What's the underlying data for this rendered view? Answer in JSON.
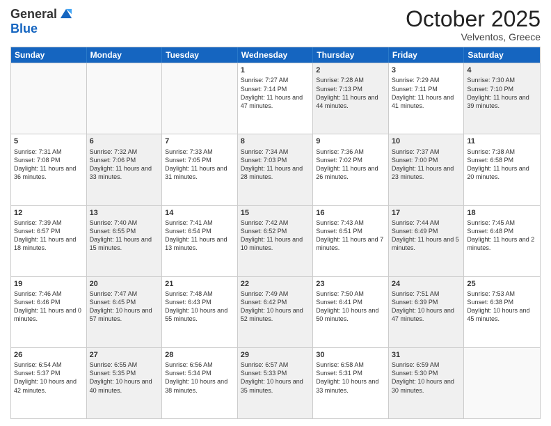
{
  "header": {
    "logo_general": "General",
    "logo_blue": "Blue",
    "month": "October 2025",
    "location": "Velventos, Greece"
  },
  "days_of_week": [
    "Sunday",
    "Monday",
    "Tuesday",
    "Wednesday",
    "Thursday",
    "Friday",
    "Saturday"
  ],
  "weeks": [
    [
      {
        "day": "",
        "sunrise": "",
        "sunset": "",
        "daylight": "",
        "shaded": false,
        "empty": true
      },
      {
        "day": "",
        "sunrise": "",
        "sunset": "",
        "daylight": "",
        "shaded": false,
        "empty": true
      },
      {
        "day": "",
        "sunrise": "",
        "sunset": "",
        "daylight": "",
        "shaded": false,
        "empty": true
      },
      {
        "day": "1",
        "sunrise": "Sunrise: 7:27 AM",
        "sunset": "Sunset: 7:14 PM",
        "daylight": "Daylight: 11 hours and 47 minutes.",
        "shaded": false,
        "empty": false
      },
      {
        "day": "2",
        "sunrise": "Sunrise: 7:28 AM",
        "sunset": "Sunset: 7:13 PM",
        "daylight": "Daylight: 11 hours and 44 minutes.",
        "shaded": true,
        "empty": false
      },
      {
        "day": "3",
        "sunrise": "Sunrise: 7:29 AM",
        "sunset": "Sunset: 7:11 PM",
        "daylight": "Daylight: 11 hours and 41 minutes.",
        "shaded": false,
        "empty": false
      },
      {
        "day": "4",
        "sunrise": "Sunrise: 7:30 AM",
        "sunset": "Sunset: 7:10 PM",
        "daylight": "Daylight: 11 hours and 39 minutes.",
        "shaded": true,
        "empty": false
      }
    ],
    [
      {
        "day": "5",
        "sunrise": "Sunrise: 7:31 AM",
        "sunset": "Sunset: 7:08 PM",
        "daylight": "Daylight: 11 hours and 36 minutes.",
        "shaded": false,
        "empty": false
      },
      {
        "day": "6",
        "sunrise": "Sunrise: 7:32 AM",
        "sunset": "Sunset: 7:06 PM",
        "daylight": "Daylight: 11 hours and 33 minutes.",
        "shaded": true,
        "empty": false
      },
      {
        "day": "7",
        "sunrise": "Sunrise: 7:33 AM",
        "sunset": "Sunset: 7:05 PM",
        "daylight": "Daylight: 11 hours and 31 minutes.",
        "shaded": false,
        "empty": false
      },
      {
        "day": "8",
        "sunrise": "Sunrise: 7:34 AM",
        "sunset": "Sunset: 7:03 PM",
        "daylight": "Daylight: 11 hours and 28 minutes.",
        "shaded": true,
        "empty": false
      },
      {
        "day": "9",
        "sunrise": "Sunrise: 7:36 AM",
        "sunset": "Sunset: 7:02 PM",
        "daylight": "Daylight: 11 hours and 26 minutes.",
        "shaded": false,
        "empty": false
      },
      {
        "day": "10",
        "sunrise": "Sunrise: 7:37 AM",
        "sunset": "Sunset: 7:00 PM",
        "daylight": "Daylight: 11 hours and 23 minutes.",
        "shaded": true,
        "empty": false
      },
      {
        "day": "11",
        "sunrise": "Sunrise: 7:38 AM",
        "sunset": "Sunset: 6:58 PM",
        "daylight": "Daylight: 11 hours and 20 minutes.",
        "shaded": false,
        "empty": false
      }
    ],
    [
      {
        "day": "12",
        "sunrise": "Sunrise: 7:39 AM",
        "sunset": "Sunset: 6:57 PM",
        "daylight": "Daylight: 11 hours and 18 minutes.",
        "shaded": false,
        "empty": false
      },
      {
        "day": "13",
        "sunrise": "Sunrise: 7:40 AM",
        "sunset": "Sunset: 6:55 PM",
        "daylight": "Daylight: 11 hours and 15 minutes.",
        "shaded": true,
        "empty": false
      },
      {
        "day": "14",
        "sunrise": "Sunrise: 7:41 AM",
        "sunset": "Sunset: 6:54 PM",
        "daylight": "Daylight: 11 hours and 13 minutes.",
        "shaded": false,
        "empty": false
      },
      {
        "day": "15",
        "sunrise": "Sunrise: 7:42 AM",
        "sunset": "Sunset: 6:52 PM",
        "daylight": "Daylight: 11 hours and 10 minutes.",
        "shaded": true,
        "empty": false
      },
      {
        "day": "16",
        "sunrise": "Sunrise: 7:43 AM",
        "sunset": "Sunset: 6:51 PM",
        "daylight": "Daylight: 11 hours and 7 minutes.",
        "shaded": false,
        "empty": false
      },
      {
        "day": "17",
        "sunrise": "Sunrise: 7:44 AM",
        "sunset": "Sunset: 6:49 PM",
        "daylight": "Daylight: 11 hours and 5 minutes.",
        "shaded": true,
        "empty": false
      },
      {
        "day": "18",
        "sunrise": "Sunrise: 7:45 AM",
        "sunset": "Sunset: 6:48 PM",
        "daylight": "Daylight: 11 hours and 2 minutes.",
        "shaded": false,
        "empty": false
      }
    ],
    [
      {
        "day": "19",
        "sunrise": "Sunrise: 7:46 AM",
        "sunset": "Sunset: 6:46 PM",
        "daylight": "Daylight: 11 hours and 0 minutes.",
        "shaded": false,
        "empty": false
      },
      {
        "day": "20",
        "sunrise": "Sunrise: 7:47 AM",
        "sunset": "Sunset: 6:45 PM",
        "daylight": "Daylight: 10 hours and 57 minutes.",
        "shaded": true,
        "empty": false
      },
      {
        "day": "21",
        "sunrise": "Sunrise: 7:48 AM",
        "sunset": "Sunset: 6:43 PM",
        "daylight": "Daylight: 10 hours and 55 minutes.",
        "shaded": false,
        "empty": false
      },
      {
        "day": "22",
        "sunrise": "Sunrise: 7:49 AM",
        "sunset": "Sunset: 6:42 PM",
        "daylight": "Daylight: 10 hours and 52 minutes.",
        "shaded": true,
        "empty": false
      },
      {
        "day": "23",
        "sunrise": "Sunrise: 7:50 AM",
        "sunset": "Sunset: 6:41 PM",
        "daylight": "Daylight: 10 hours and 50 minutes.",
        "shaded": false,
        "empty": false
      },
      {
        "day": "24",
        "sunrise": "Sunrise: 7:51 AM",
        "sunset": "Sunset: 6:39 PM",
        "daylight": "Daylight: 10 hours and 47 minutes.",
        "shaded": true,
        "empty": false
      },
      {
        "day": "25",
        "sunrise": "Sunrise: 7:53 AM",
        "sunset": "Sunset: 6:38 PM",
        "daylight": "Daylight: 10 hours and 45 minutes.",
        "shaded": false,
        "empty": false
      }
    ],
    [
      {
        "day": "26",
        "sunrise": "Sunrise: 6:54 AM",
        "sunset": "Sunset: 5:37 PM",
        "daylight": "Daylight: 10 hours and 42 minutes.",
        "shaded": false,
        "empty": false
      },
      {
        "day": "27",
        "sunrise": "Sunrise: 6:55 AM",
        "sunset": "Sunset: 5:35 PM",
        "daylight": "Daylight: 10 hours and 40 minutes.",
        "shaded": true,
        "empty": false
      },
      {
        "day": "28",
        "sunrise": "Sunrise: 6:56 AM",
        "sunset": "Sunset: 5:34 PM",
        "daylight": "Daylight: 10 hours and 38 minutes.",
        "shaded": false,
        "empty": false
      },
      {
        "day": "29",
        "sunrise": "Sunrise: 6:57 AM",
        "sunset": "Sunset: 5:33 PM",
        "daylight": "Daylight: 10 hours and 35 minutes.",
        "shaded": true,
        "empty": false
      },
      {
        "day": "30",
        "sunrise": "Sunrise: 6:58 AM",
        "sunset": "Sunset: 5:31 PM",
        "daylight": "Daylight: 10 hours and 33 minutes.",
        "shaded": false,
        "empty": false
      },
      {
        "day": "31",
        "sunrise": "Sunrise: 6:59 AM",
        "sunset": "Sunset: 5:30 PM",
        "daylight": "Daylight: 10 hours and 30 minutes.",
        "shaded": true,
        "empty": false
      },
      {
        "day": "",
        "sunrise": "",
        "sunset": "",
        "daylight": "",
        "shaded": false,
        "empty": true
      }
    ]
  ]
}
